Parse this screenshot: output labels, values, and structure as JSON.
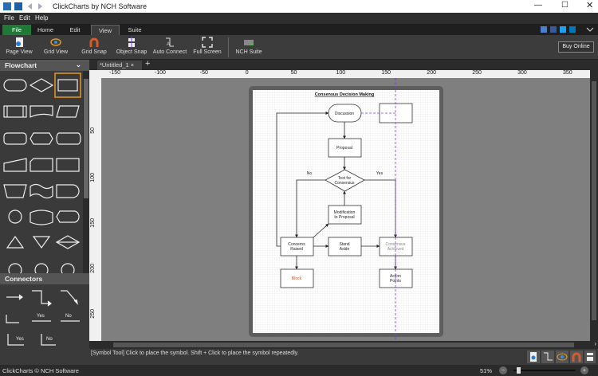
{
  "app": {
    "title": "ClickCharts by NCH Software",
    "footer": "ClickCharts © NCH Software"
  },
  "menu": [
    "File",
    "Edit",
    "Help"
  ],
  "tabs": [
    "File",
    "Home",
    "Edit",
    "View",
    "Suite"
  ],
  "active_tab": "View",
  "ribbon": [
    "Page View",
    "Grid View",
    "Grid Snap",
    "Object Snap",
    "Auto Connect",
    "Full Screen",
    "NCH Suite"
  ],
  "buy_online": "Buy Online",
  "panel": {
    "flowchart": "Flowchart",
    "connectors": "Connectors",
    "conn_labels": [
      "Yes",
      "No",
      "Yes",
      "No"
    ]
  },
  "doc_tab": "*Untitled_1",
  "ruler_x": [
    "-150",
    "-100",
    "-50",
    "0",
    "50",
    "100",
    "150",
    "200",
    "250",
    "300",
    "350"
  ],
  "ruler_y": [
    "50",
    "100",
    "150",
    "200",
    "250"
  ],
  "diagram": {
    "title": "Consensus Decision Making",
    "discussion": "Discussion",
    "proposal": "Proposal",
    "test1": "Test for",
    "test2": "Consensus",
    "mod1": "Modification",
    "mod2": "to Proposal",
    "concerns1": "Concerns",
    "concerns2": "Raised",
    "stand1": "Stand",
    "stand2": "Aside",
    "cons1": "Consensus",
    "cons2": "Achieved",
    "block": "Block",
    "action1": "Action",
    "action2": "Points",
    "no": "No",
    "yes": "Yes"
  },
  "status": "[Symbol Tool] Click to place the symbol.  Shift + Click to place the symbol repeatedly.",
  "zoom": "51%",
  "zoom_level": 51,
  "colors": {
    "accent": "#1e7a34",
    "selection": "#e69a1e",
    "guide": "#7b3ff2",
    "block_text": "#d0531b"
  }
}
